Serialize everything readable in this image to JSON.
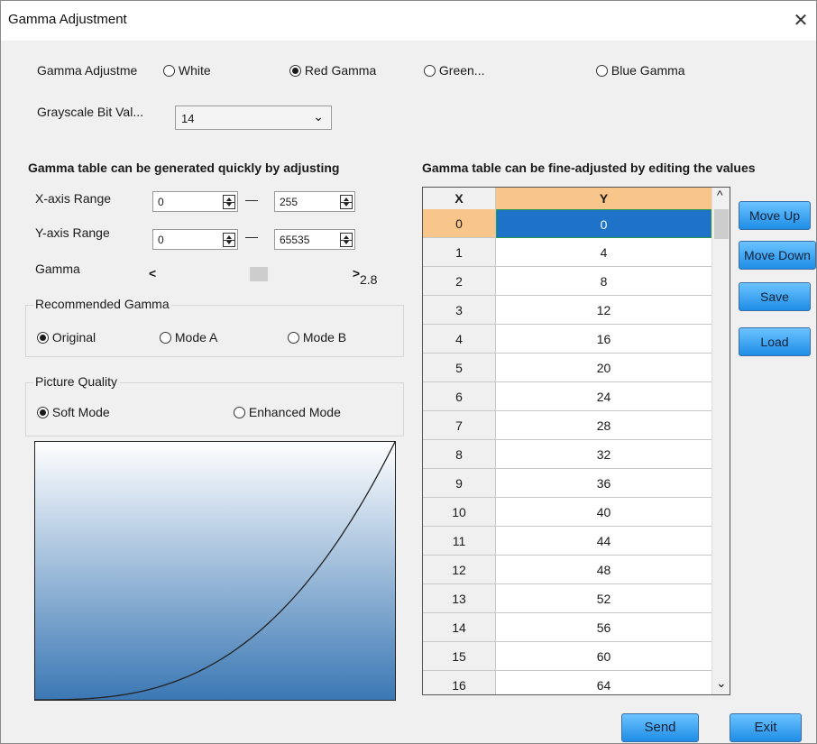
{
  "window": {
    "title": "Gamma Adjustment",
    "close_glyph": "✕"
  },
  "gamma_adjustment": {
    "label": "Gamma Adjustme",
    "options": [
      "White",
      "Red Gamma",
      "Green...",
      "Blue Gamma"
    ],
    "selected": "Red Gamma"
  },
  "grayscale": {
    "label": "Grayscale Bit Val...",
    "value": "14"
  },
  "left_heading": "Gamma table can be generated quickly by adjusting",
  "right_heading": "Gamma table can be fine-adjusted by editing the values",
  "x_range": {
    "label": "X-axis Range",
    "min": "0",
    "max": "255",
    "dash": "—"
  },
  "y_range": {
    "label": "Y-axis Range",
    "min": "0",
    "max": "65535",
    "dash": "—"
  },
  "gamma": {
    "label": "Gamma",
    "value": "2.8",
    "slider_fraction": 0.55,
    "left_arrow": "<",
    "right_arrow": ">"
  },
  "recommended": {
    "label": "Recommended Gamma",
    "options": [
      "Original",
      "Mode A",
      "Mode B"
    ],
    "selected": "Original"
  },
  "picture_quality": {
    "label": "Picture Quality",
    "options": [
      "Soft Mode",
      "Enhanced Mode"
    ],
    "selected": "Soft Mode"
  },
  "table": {
    "headers": [
      "X",
      "Y"
    ],
    "rows": [
      [
        "0",
        "0"
      ],
      [
        "1",
        "4"
      ],
      [
        "2",
        "8"
      ],
      [
        "3",
        "12"
      ],
      [
        "4",
        "16"
      ],
      [
        "5",
        "20"
      ],
      [
        "6",
        "24"
      ],
      [
        "7",
        "28"
      ],
      [
        "8",
        "32"
      ],
      [
        "9",
        "36"
      ],
      [
        "10",
        "40"
      ],
      [
        "11",
        "44"
      ],
      [
        "12",
        "48"
      ],
      [
        "13",
        "52"
      ],
      [
        "14",
        "56"
      ],
      [
        "15",
        "60"
      ],
      [
        "16",
        "64"
      ]
    ],
    "selected_row": 0,
    "scroll_up": "^",
    "scroll_down": "⌄"
  },
  "side_buttons": {
    "move_up": "Move Up",
    "move_down": "Move Down",
    "save": "Save",
    "load": "Load"
  },
  "footer": {
    "send": "Send",
    "exit": "Exit"
  },
  "colors": {
    "selected_cell": "#1e73c8",
    "header_y": "#f8c58a",
    "button": "#1e8de6"
  }
}
